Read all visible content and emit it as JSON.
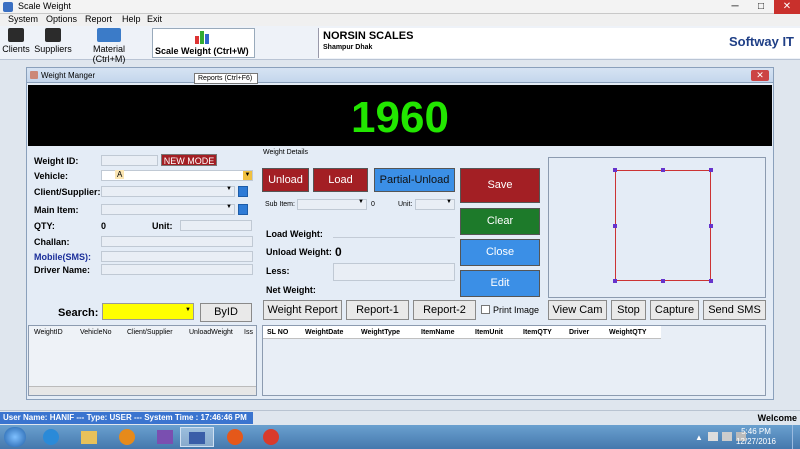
{
  "window": {
    "title": "Scale Weight",
    "minimize": "─",
    "maximize": "□",
    "close": "✕"
  },
  "menu": [
    "System",
    "Options",
    "Report",
    "Help",
    "Exit"
  ],
  "toolbar": {
    "clients": "Clients",
    "suppliers": "Suppliers",
    "material": "Material (Ctrl+M)",
    "scale_weight": "Scale Weight (Ctrl+W)",
    "tooltip": "Reports (Ctrl+F6)"
  },
  "company": {
    "name": "NORSIN SCALES",
    "address": "Shampur Dhak",
    "brand": "Softway IT"
  },
  "inner": {
    "title": "Weight Manger",
    "close": "✕"
  },
  "display": {
    "weight": "1960"
  },
  "left": {
    "weight_id": "Weight ID:",
    "mode": "NEW MODE",
    "vehicle": "Vehicle:",
    "vehicle_value": "A",
    "client": "Client/Supplier:",
    "main_item": "Main Item:",
    "qty": "QTY:",
    "qty_value": "0",
    "unit": "Unit:",
    "challan": "Challan:",
    "mobile": "Mobile(SMS):",
    "driver": "Driver Name:",
    "search": "Search:",
    "byid": "ByID"
  },
  "details": {
    "group": "Weight Details",
    "unload": "Unload",
    "load": "Load",
    "partial": "Partial-Unload",
    "sub_item": "Sub Item:",
    "sub_qty": "0",
    "unit": "Unit:",
    "load_weight": "Load Weight:",
    "unload_weight": "Unload Weight:",
    "unload_value": "0",
    "less": "Less:",
    "net_weight": "Net Weight:"
  },
  "actions": {
    "save": "Save",
    "clear": "Clear",
    "close": "Close",
    "edit": "Edit"
  },
  "reports": {
    "weight_report": "Weight Report",
    "report1": "Report-1",
    "report2": "Report-2",
    "print_image": "Print Image"
  },
  "camera": {
    "view": "View Cam",
    "stop": "Stop",
    "capture": "Capture",
    "sms": "Send SMS"
  },
  "grid1": {
    "columns": [
      "WeightID",
      "VehicleNo",
      "Client/Supplier",
      "UnloadWeight",
      "Iss"
    ]
  },
  "grid2": {
    "columns": [
      "SL NO",
      "WeightDate",
      "WeightType",
      "ItemName",
      "ItemUnit",
      "ItemQTY",
      "Driver",
      "WeightQTY"
    ]
  },
  "status": {
    "text": "User Name: HANIF --- Type: USER ---   System Time : 17:46:46 PM",
    "welcome": "Welcome"
  },
  "taskbar": {
    "time": "5:46 PM",
    "date": "12/27/2016"
  },
  "colors": {
    "red": "#a31f24",
    "green": "#1d7a2a",
    "blue": "#3b8fe6",
    "display_text": "#22e600"
  }
}
